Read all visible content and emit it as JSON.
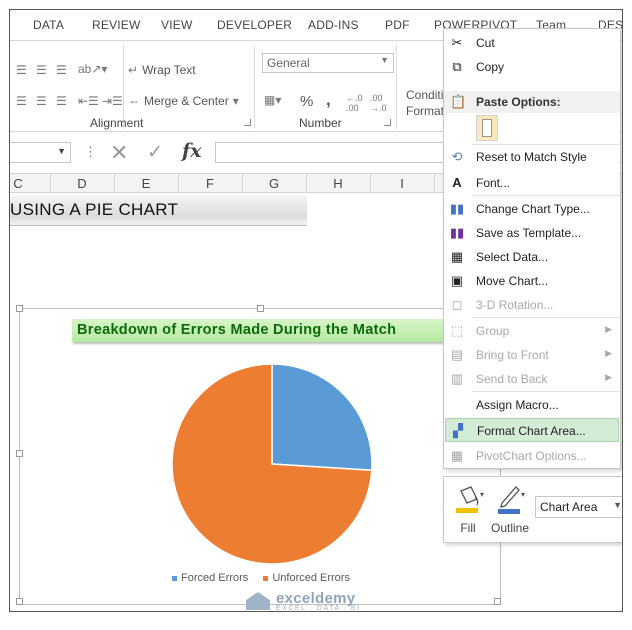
{
  "ribbon": {
    "tabs": [
      "DATA",
      "REVIEW",
      "VIEW",
      "DEVELOPER",
      "ADD-INS",
      "PDF",
      "POWERPIVOT",
      "Team",
      "DESIG"
    ],
    "wrap_text": "Wrap Text",
    "merge_center": "Merge & Center",
    "number_format": "General",
    "percent": "%",
    "comma": ",",
    "cond_format_line1": "Conditi",
    "cond_format_line2": "Formatt",
    "groups": {
      "alignment": "Alignment",
      "number": "Number"
    }
  },
  "formula_bar": {
    "fx": "fx"
  },
  "columns": [
    "C",
    "D",
    "E",
    "F",
    "G",
    "H",
    "I"
  ],
  "sheet": {
    "banner_title": "USING A PIE CHART"
  },
  "chart_data": {
    "type": "pie",
    "title": "Breakdown of Errors Made During the Match",
    "categories": [
      "Forced Errors",
      "Unforced Errors"
    ],
    "values": [
      26,
      74
    ],
    "colors": [
      "#5b9bd5",
      "#ed7d31"
    ],
    "legend_position": "bottom"
  },
  "context_menu": {
    "items": [
      {
        "label": "Cut",
        "icon": "scissors-icon",
        "enabled": true
      },
      {
        "label": "Copy",
        "icon": "copy-icon",
        "enabled": true
      },
      {
        "label": "Paste Options:",
        "icon": "paste-icon",
        "enabled": true
      },
      {
        "label": "Reset to Match Style",
        "icon": "reset-style-icon",
        "enabled": true
      },
      {
        "label": "Font...",
        "icon": "font-icon",
        "enabled": true
      },
      {
        "label": "Change Chart Type...",
        "icon": "chart-type-icon",
        "enabled": true
      },
      {
        "label": "Save as Template...",
        "icon": "template-icon",
        "enabled": true
      },
      {
        "label": "Select Data...",
        "icon": "select-data-icon",
        "enabled": true
      },
      {
        "label": "Move Chart...",
        "icon": "move-chart-icon",
        "enabled": true
      },
      {
        "label": "3-D Rotation...",
        "icon": "rotation-icon",
        "enabled": false
      },
      {
        "label": "Group",
        "icon": "group-icon",
        "enabled": false
      },
      {
        "label": "Bring to Front",
        "icon": "bring-front-icon",
        "enabled": false
      },
      {
        "label": "Send to Back",
        "icon": "send-back-icon",
        "enabled": false
      },
      {
        "label": "Assign Macro...",
        "icon": "macro-icon",
        "enabled": true
      },
      {
        "label": "Format Chart Area...",
        "icon": "format-chart-icon",
        "enabled": true,
        "highlighted": true
      },
      {
        "label": "PivotChart Options...",
        "icon": "pivot-icon",
        "enabled": false
      }
    ]
  },
  "mini_toolbar": {
    "fill_label": "Fill",
    "outline_label": "Outline",
    "element_select": "Chart Area"
  },
  "watermark": {
    "brand": "exceldemy",
    "tagline": "EXCEL · DATA · BI"
  }
}
